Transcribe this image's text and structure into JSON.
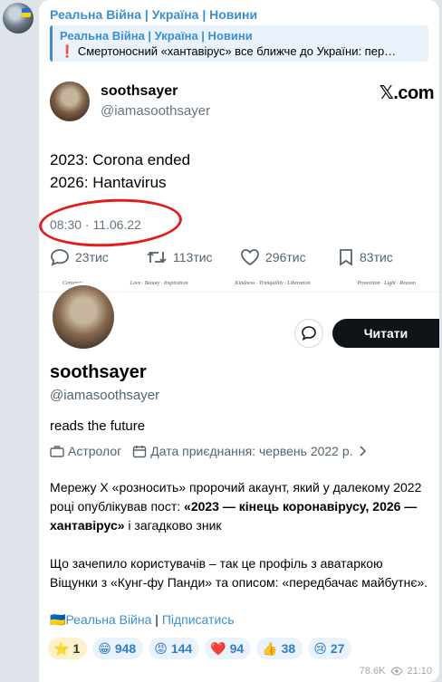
{
  "channel": {
    "name": "Реальна Війна | Україна | Новини"
  },
  "reply": {
    "title": "Реальна Війна | Україна | Новини",
    "mark": "❗",
    "text": "Смертоносний «хантавірус» все ближче до України: пер…"
  },
  "tweet": {
    "name": "soothsayer",
    "handle": "@iamasoothsayer",
    "brand": "𝕏.com",
    "line1": "2023: Corona ended",
    "line2": "2026: Hantavirus",
    "time": "08:30 · 11.06.22",
    "replies": "23тис",
    "retweets": "113тис",
    "likes": "296тис",
    "bookmarks": "83тис"
  },
  "profile": {
    "strip": [
      "Certainty",
      "Love · Beauty · Inspiration",
      "Kindness · Tranquility · Liberation",
      "Protection · Light · Reason"
    ],
    "follow": "Читати",
    "name": "soothsayer",
    "handle": "@iamasoothsayer",
    "bio": "reads the future",
    "category": "Астролог",
    "joined": "Дата приєднання: червень 2022 р."
  },
  "post": {
    "p1_a": "Мережу X «розносить» пророчий акаунт, який у далекому 2022 році опублікував пост: ",
    "p1_b": "«2023 — кінець коронавірусу, 2026 — хантавірус»",
    "p1_c": " і загадково зник",
    "p2": "Що зачепило користувачів – так це профіль з аватаркою Віщунки з «Кунг-фу Панди» та описом: «передбачає майбутнє».",
    "source_flag": "🇺🇦",
    "source_link": "Реальна Війна",
    "sep": " | ",
    "subscribe": "Підписатись"
  },
  "reactions": [
    {
      "emoji": "⭐",
      "count": "1"
    },
    {
      "emoji": "😁",
      "count": "948"
    },
    {
      "emoji": "😡",
      "count": "144"
    },
    {
      "emoji": "❤️",
      "count": "94"
    },
    {
      "emoji": "👍",
      "count": "38"
    },
    {
      "emoji": "😢",
      "count": "27"
    }
  ],
  "footer": {
    "views": "78.6K",
    "time": "21:10"
  },
  "colors": {
    "accent": "#3b8fd1",
    "highlight_circle": "#e31b1b",
    "button_dark": "#0f1419"
  }
}
